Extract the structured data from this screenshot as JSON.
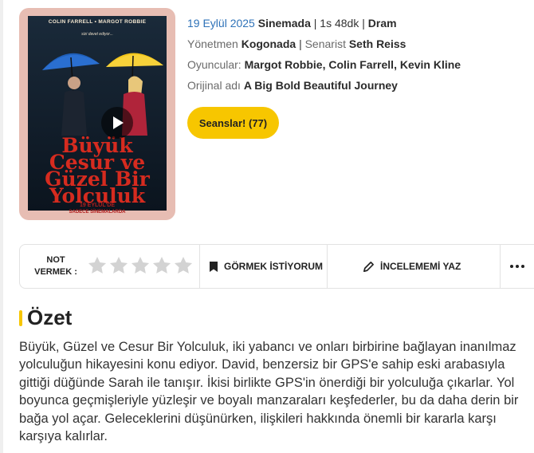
{
  "poster": {
    "cast": "COLIN FARRELL  •  MARGOT ROBBIE",
    "tagline": "sizi davet ediyor...",
    "title_lines": [
      "Büyük",
      "Cesur ve",
      "Güzel Bir",
      "Yolculuk"
    ],
    "release_date": "19 EYLÜL'DE",
    "release_note": "SADECE SİNEMALARDA",
    "play_icon": "play-icon"
  },
  "details": {
    "release_date": "19 Eylül 2025",
    "status": "Sinemada",
    "separator": "|",
    "duration": "1s 48dk",
    "genre": "Dram",
    "director_label": "Yönetmen",
    "director": "Kogonada",
    "writer_label": "Senarist",
    "writer": "Seth Reiss",
    "cast_label": "Oyuncular:",
    "cast": [
      "Margot Robbie",
      "Colin Farrell",
      "Kevin Kline"
    ],
    "comma": ",",
    "original_title_label": "Orijinal adı",
    "original_title": "A Big Bold Beautiful Journey"
  },
  "cta": {
    "sessions_label": "Seanslar! (77)"
  },
  "action_bar": {
    "rate_label": "NOT VERMEK :",
    "rating": {
      "value": 0,
      "max": 5
    },
    "star_icon": "star-icon",
    "watchlist_icon": "bookmark-icon",
    "watchlist_label": "GÖRMEK İSTİYORUM",
    "review_icon": "pencil-icon",
    "review_label": "İNCELEMEMİ YAZ",
    "more_icon": "more-dots-icon"
  },
  "summary": {
    "heading": "Özet",
    "text": "Büyük, Güzel ve Cesur Bir Yolculuk, iki yabancı ve onları birbirine bağlayan inanılmaz yolculuğun hikayesini konu ediyor. David, benzersiz bir GPS'e sahip eski arabasıyla gittiği düğünde Sarah ile tanışır. İkisi birlikte GPS'in önerdiği bir yolculuğa çıkarlar. Yol boyunca geçmişleriyle yüzleşir ve boyalı manzaraları keşfederler, bu da daha derin bir bağa yol açar. Geleceklerini düşünürken, ilişkileri hakkında önemli bir kararla karşı karşıya kalırlar."
  },
  "colors": {
    "accent_yellow": "#f7c600",
    "link_blue": "#2e72b8",
    "poster_pink": "#e7bdb3",
    "poster_title_red": "#d62b1f",
    "star_gray": "#d3d3d3"
  }
}
